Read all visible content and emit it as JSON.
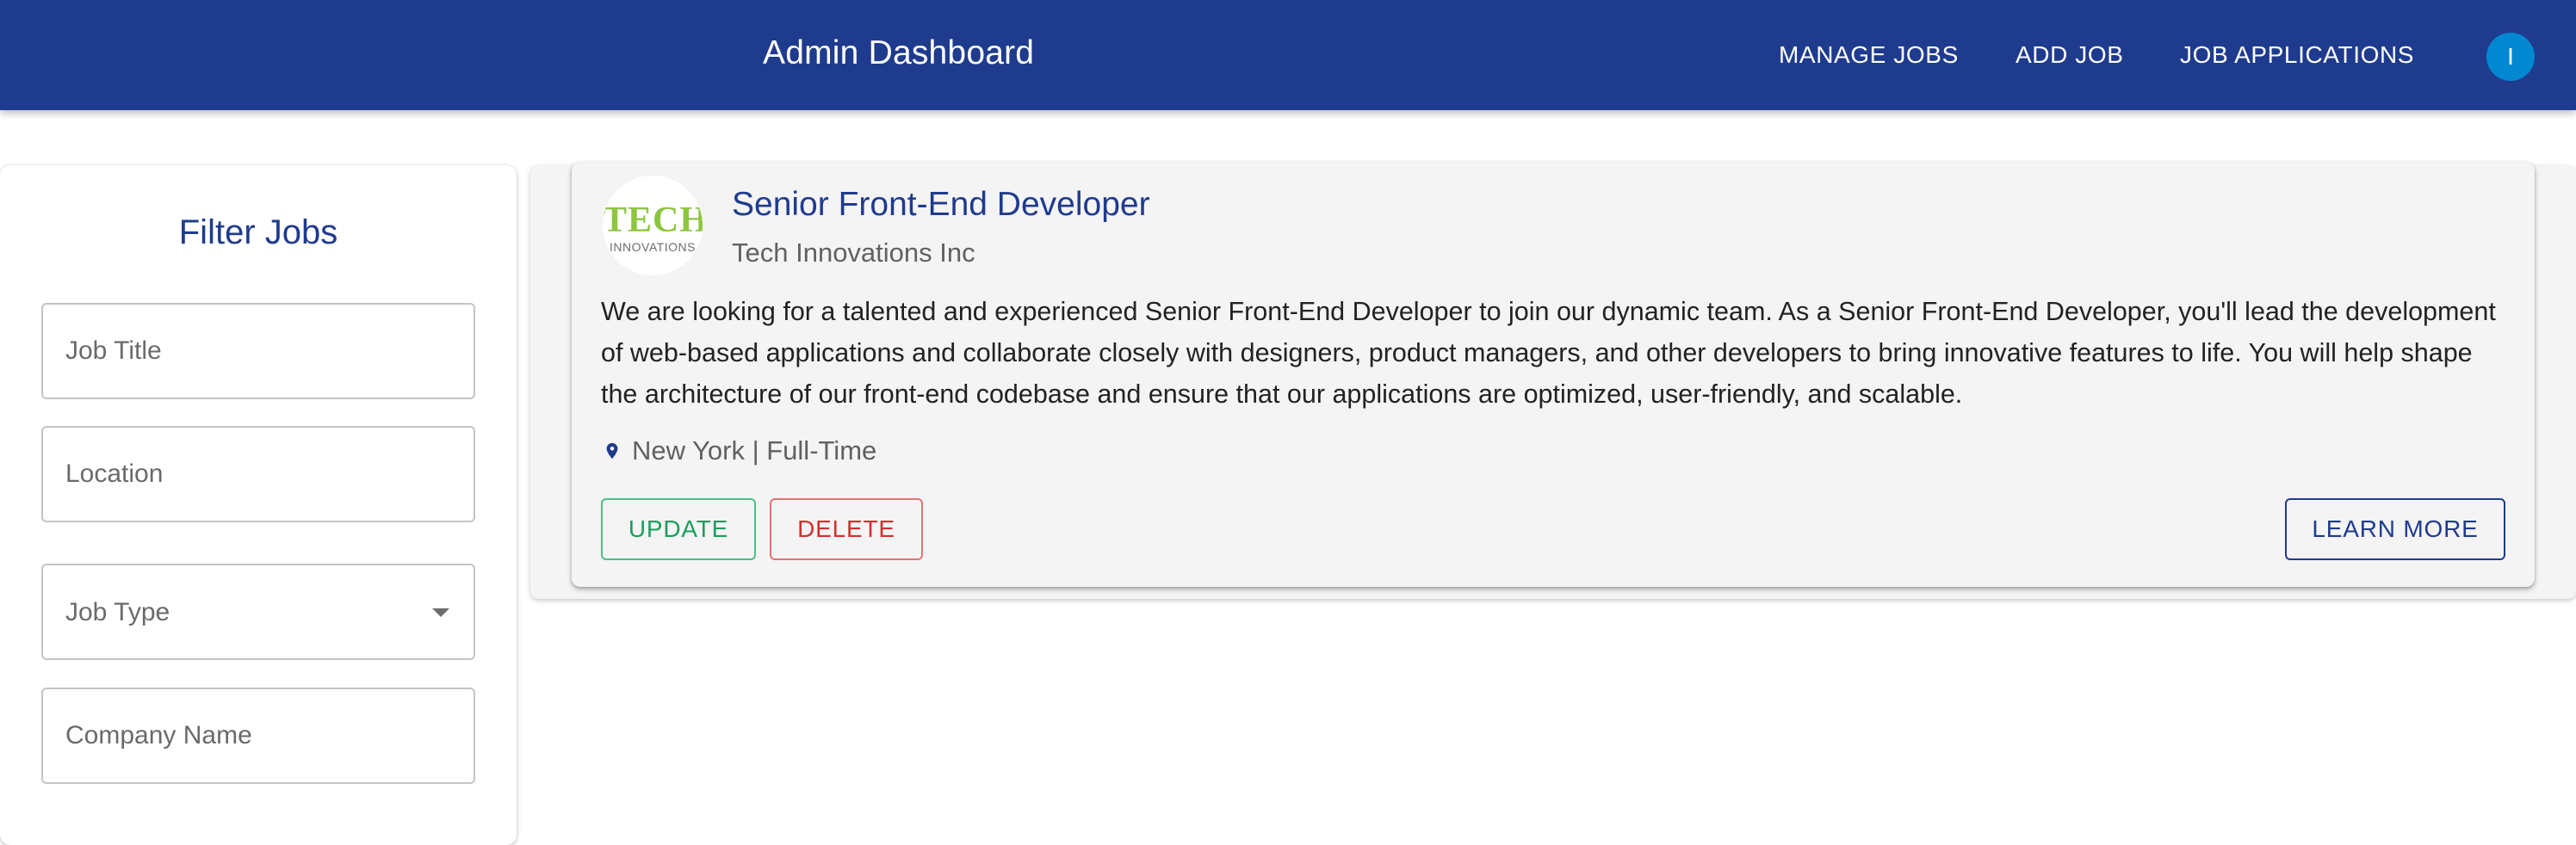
{
  "header": {
    "title": "Admin Dashboard",
    "nav": {
      "manage_jobs": "MANAGE JOBS",
      "add_job": "ADD JOB",
      "job_applications": "JOB APPLICATIONS"
    },
    "avatar_initial": "I",
    "colors": {
      "bar": "#1f3b8e",
      "avatar": "#0288d1"
    }
  },
  "filters": {
    "title": "Filter Jobs",
    "job_title_placeholder": "Job Title",
    "location_placeholder": "Location",
    "job_type_label": "Job Type",
    "company_name_placeholder": "Company Name"
  },
  "jobs": [
    {
      "title": "Senior Front-End Developer",
      "company": "Tech Innovations Inc",
      "logo_text": "TECH",
      "logo_subtext": "INNOVATIONS",
      "description": "We are looking for a talented and experienced Senior Front-End Developer to join our dynamic team. As a Senior Front-End Developer, you'll lead the development of web-based applications and collaborate closely with designers, product managers, and other developers to bring innovative features to life. You will help shape the architecture of our front-end codebase and ensure that our applications are optimized, user-friendly, and scalable.",
      "location_type": "New York | Full-Time",
      "actions": {
        "update": "UPDATE",
        "delete": "DELETE",
        "learn_more": "LEARN MORE"
      }
    }
  ],
  "icons": {
    "location": "location-pin-icon",
    "dropdown": "caret-down-icon"
  }
}
